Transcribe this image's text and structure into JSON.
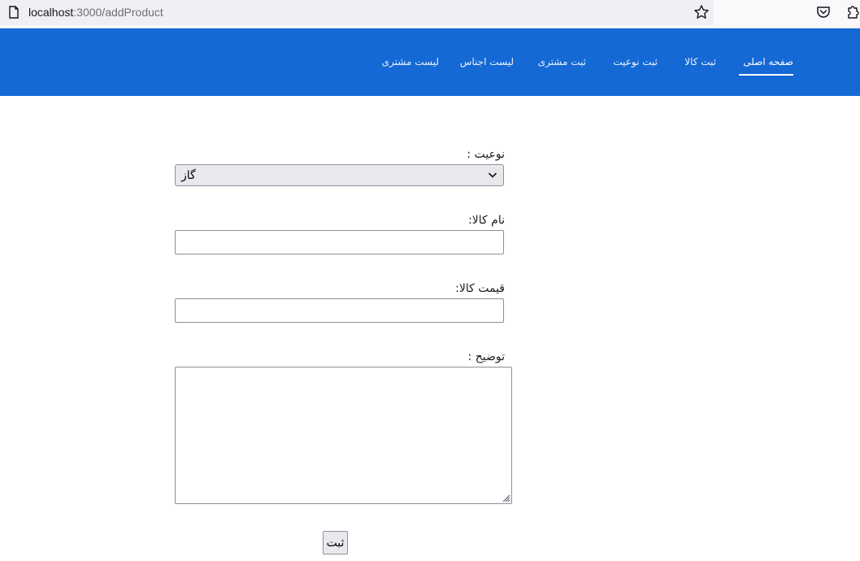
{
  "browser": {
    "url_host": "localhost",
    "url_path": ":3000/addProduct",
    "icons": [
      "page-icon",
      "star-icon",
      "pocket-icon",
      "extensions-icon"
    ]
  },
  "navbar": {
    "background": "#1469d4",
    "items": [
      {
        "label": "صفحه اصلی",
        "active": true
      },
      {
        "label": "ثبت کالا",
        "active": false
      },
      {
        "label": "ثبت نوعیت",
        "active": false
      },
      {
        "label": "ثبت مشتری",
        "active": false
      },
      {
        "label": "لیست اجناس",
        "active": false
      },
      {
        "label": "لیست مشتری",
        "active": false
      }
    ]
  },
  "form": {
    "type_label": "نوعیت :",
    "type_selected": "گاز",
    "name_label": "نام کالا:",
    "name_value": "",
    "price_label": "قیمت کالا:",
    "price_value": "",
    "description_label": "توضیح :",
    "description_value": "",
    "submit_label": "ثبت"
  }
}
